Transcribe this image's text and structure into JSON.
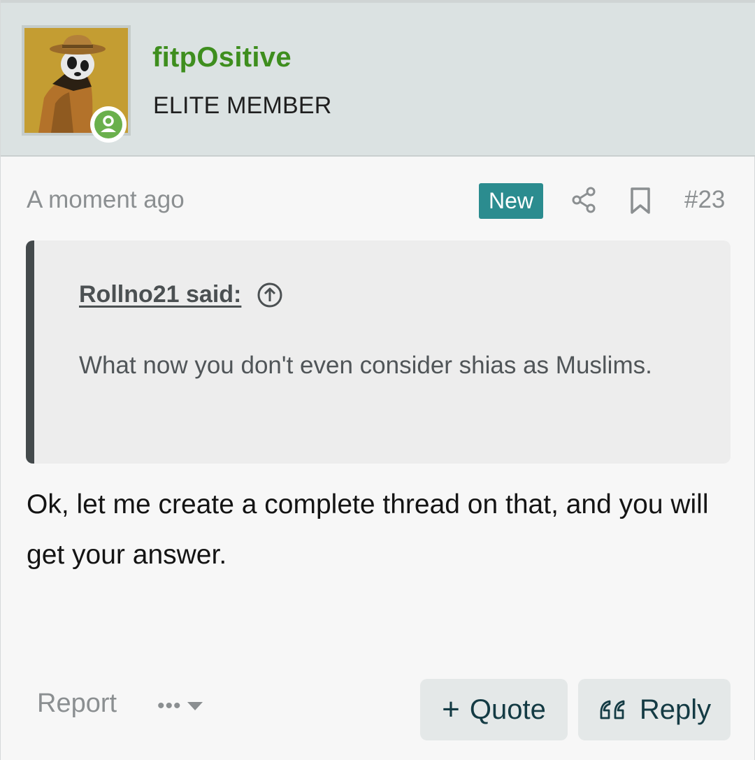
{
  "user": {
    "name": "fitpOsitive",
    "title": "ELITE MEMBER",
    "status": "online"
  },
  "meta": {
    "time": "A moment ago",
    "badge": "New",
    "post_number": "#23"
  },
  "quote": {
    "author": "Rollno21 said:",
    "text": "What now you don't even consider shias as Muslims."
  },
  "body": {
    "text": "Ok, let me create a complete thread on that, and you will get your answer."
  },
  "actions": {
    "report": "Report",
    "more": "•••",
    "quote": "Quote",
    "reply": "Reply"
  },
  "colors": {
    "header_bg": "#dbe2e2",
    "username": "#3e8e1e",
    "badge_bg": "#2b8c8f",
    "button_text": "#143b44",
    "online": "#6ab04c"
  },
  "icons": {
    "share": "share-icon",
    "bookmark": "bookmark-icon",
    "quote_jump": "arrow-up-circle-icon",
    "reply": "quote-marks-icon"
  }
}
